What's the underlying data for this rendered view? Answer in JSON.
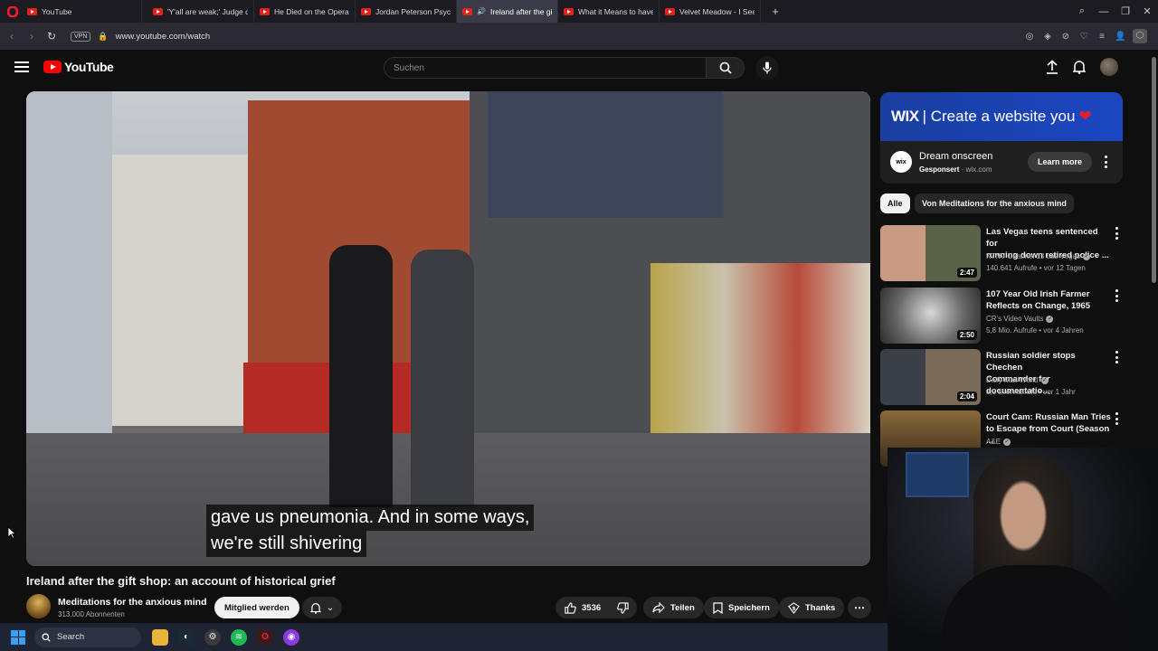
{
  "browser": {
    "tabs": [
      {
        "label": "YouTube",
        "active": false
      },
      {
        "label": "'Y'all are weak;' Judge do",
        "active": false
      },
      {
        "label": "He Died on the Operating",
        "active": false
      },
      {
        "label": "Jordan Peterson Psychoan",
        "active": false
      },
      {
        "label": "Ireland after the gift s",
        "active": true
      },
      {
        "label": "What it Means to have an",
        "active": false
      },
      {
        "label": "Velvet Meadow - I See Blo",
        "active": false
      }
    ],
    "vpn_label": "VPN",
    "url": "www.youtube.com/watch"
  },
  "youtube": {
    "logo_text": "YouTube",
    "search_placeholder": "Suchen",
    "caption_lines": [
      "gave us pneumonia. And in some ways,",
      "we're still shivering"
    ],
    "video_title": "Ireland after the gift shop: an account of historical grief",
    "channel": {
      "name": "Meditations for the anxious mind",
      "subscribers": "313.000 Abonnenten"
    },
    "join_label": "Mitglied werden",
    "likes": "3536",
    "share_label": "Teilen",
    "save_label": "Speichern",
    "thanks_label": "Thanks",
    "ad": {
      "banner_brand": "WIX",
      "banner_text": "| Create a website you",
      "logo": "wix",
      "title": "Dream onscreen",
      "sponsored": "Gesponsert",
      "domain": "· wix.com",
      "cta": "Learn more"
    },
    "chips": [
      "Alle",
      "Von Meditations for the anxious mind"
    ],
    "recommendations": [
      {
        "title": "Las Vegas teens sentenced for\nrunning down retired police ...",
        "channel": "KTNV Channel 13 Las Vegas",
        "meta": "140.641 Aufrufe • vor 12 Tagen",
        "duration": "2:47"
      },
      {
        "title": "107 Year Old Irish Farmer\nReflects on Change, 1965",
        "channel": "CR's Video Vaults",
        "meta": "5,8 Mio. Aufrufe • vor 4 Jahren",
        "duration": "2:50"
      },
      {
        "title": "Russian soldier stops Chechen\nCommander for documentatio...",
        "channel": "Daily Mail World",
        "meta": "3,3 Mio. Aufrufe • vor 1 Jahr",
        "duration": "2:04"
      },
      {
        "title": "Court Cam: Russian Man Tries\nto Escape from Court (Season ...",
        "channel": "A&E",
        "meta": "",
        "duration": ""
      }
    ]
  },
  "taskbar": {
    "search_label": "Search"
  },
  "colors": {
    "brand_red": "#ff0000",
    "wix_blue": "#1b46c2",
    "bg": "#0f0f0f"
  }
}
